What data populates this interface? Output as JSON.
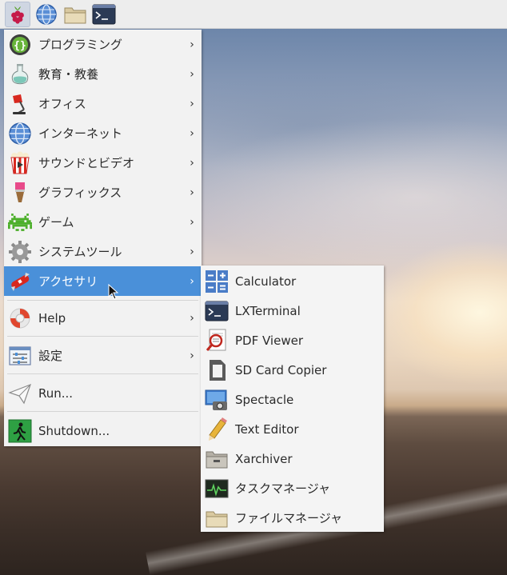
{
  "panel": {
    "buttons": [
      {
        "name": "raspberry-menu-button",
        "icon": "raspberry-icon"
      },
      {
        "name": "web-browser-button",
        "icon": "globe-icon"
      },
      {
        "name": "file-manager-button",
        "icon": "folder-icon"
      },
      {
        "name": "terminal-button",
        "icon": "terminal-icon"
      }
    ]
  },
  "main_menu": {
    "items": [
      {
        "label": "プログラミング",
        "icon": "braces-icon",
        "submenu": true
      },
      {
        "label": "教育・教養",
        "icon": "flask-icon",
        "submenu": true
      },
      {
        "label": "オフィス",
        "icon": "desk-lamp-icon",
        "submenu": true
      },
      {
        "label": "インターネット",
        "icon": "globe-icon",
        "submenu": true
      },
      {
        "label": "サウンドとビデオ",
        "icon": "popcorn-icon",
        "submenu": true
      },
      {
        "label": "グラフィックス",
        "icon": "paintbrush-icon",
        "submenu": true
      },
      {
        "label": "ゲーム",
        "icon": "space-invader-icon",
        "submenu": true
      },
      {
        "label": "システムツール",
        "icon": "gear-icon",
        "submenu": true
      },
      {
        "label": "アクセサリ",
        "icon": "swiss-knife-icon",
        "submenu": true,
        "selected": true
      },
      {
        "label": "Help",
        "icon": "lifebuoy-icon",
        "submenu": true
      },
      {
        "label": "設定",
        "icon": "preferences-icon",
        "submenu": true
      },
      {
        "label": "Run...",
        "icon": "paper-plane-icon",
        "submenu": false
      },
      {
        "label": "Shutdown...",
        "icon": "exit-icon",
        "submenu": false
      }
    ],
    "arrow_glyph": "›"
  },
  "accessories_menu": {
    "items": [
      {
        "label": "Calculator",
        "icon": "calculator-icon"
      },
      {
        "label": "LXTerminal",
        "icon": "terminal-icon"
      },
      {
        "label": "PDF Viewer",
        "icon": "pdf-viewer-icon"
      },
      {
        "label": "SD Card Copier",
        "icon": "sd-card-icon"
      },
      {
        "label": "Spectacle",
        "icon": "screenshot-icon"
      },
      {
        "label": "Text Editor",
        "icon": "pencil-icon"
      },
      {
        "label": "Xarchiver",
        "icon": "archive-icon"
      },
      {
        "label": "タスクマネージャ",
        "icon": "task-manager-icon"
      },
      {
        "label": "ファイルマネージャ",
        "icon": "folder-icon"
      }
    ]
  },
  "colors": {
    "selection": "#4a90d9",
    "menu_bg": "#f2f2f2",
    "panel_bg": "#ededed"
  }
}
